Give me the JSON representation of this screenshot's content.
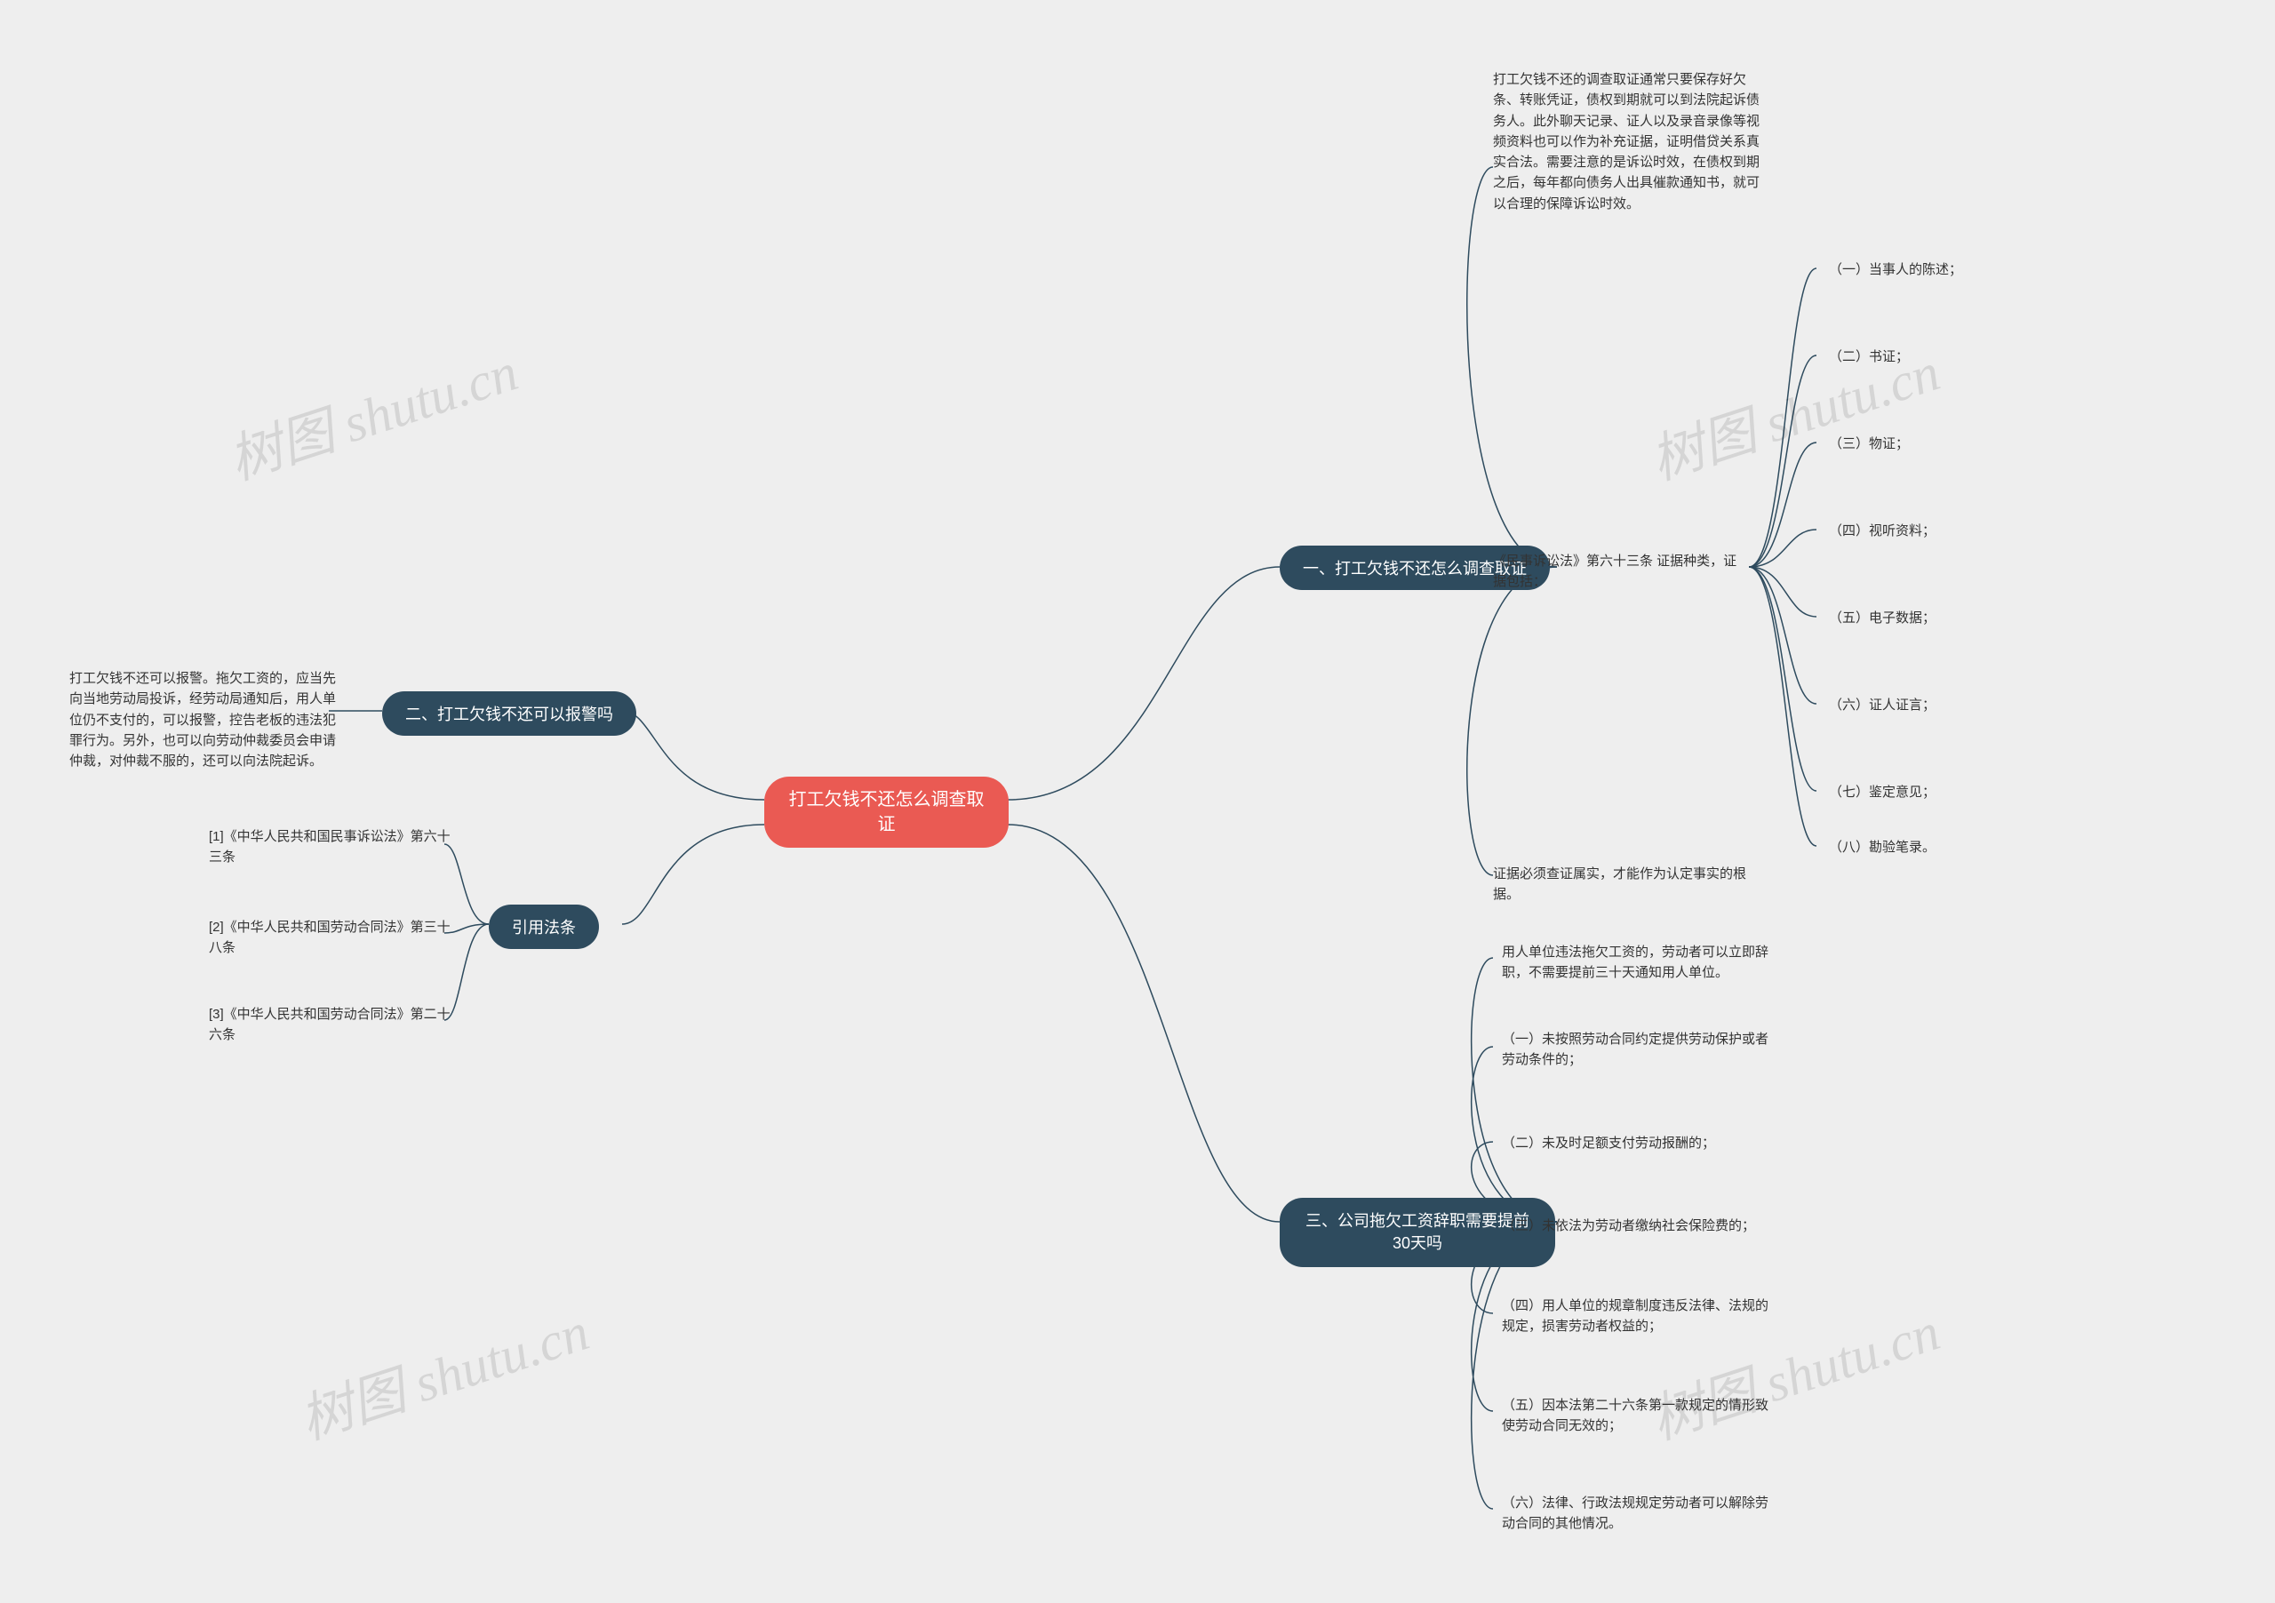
{
  "root": {
    "title": "打工欠钱不还怎么调查取证"
  },
  "branch1": {
    "title": "一、打工欠钱不还怎么调查取证",
    "intro": "打工欠钱不还的调查取证通常只要保存好欠条、转账凭证，债权到期就可以到法院起诉债务人。此外聊天记录、证人以及录音录像等视频资料也可以作为补充证据，证明借贷关系真实合法。需要注意的是诉讼时效，在债权到期之后，每年都向债务人出具催款通知书，就可以合理的保障诉讼时效。",
    "law_line": "《民事诉讼法》第六十三条 证据种类，证据包括：",
    "items": {
      "i1": "（一）当事人的陈述；",
      "i2": "（二）书证；",
      "i3": "（三）物证；",
      "i4": "（四）视听资料；",
      "i5": "（五）电子数据；",
      "i6": "（六）证人证言；",
      "i7": "（七）鉴定意见；",
      "i8": "（八）勘验笔录。"
    },
    "footer": "证据必须查证属实，才能作为认定事实的根据。"
  },
  "branch2": {
    "title": "二、打工欠钱不还可以报警吗",
    "content": "打工欠钱不还可以报警。拖欠工资的，应当先向当地劳动局投诉，经劳动局通知后，用人单位仍不支付的，可以报警，控告老板的违法犯罪行为。另外，也可以向劳动仲裁委员会申请仲裁，对仲裁不服的，还可以向法院起诉。"
  },
  "branch3": {
    "title": "三、公司拖欠工资辞职需要提前30天吗",
    "intro": "用人单位违法拖欠工资的，劳动者可以立即辞职，不需要提前三十天通知用人单位。",
    "items": {
      "i1": "（一）未按照劳动合同约定提供劳动保护或者劳动条件的；",
      "i2": "（二）未及时足额支付劳动报酬的；",
      "i3": "（三）未依法为劳动者缴纳社会保险费的；",
      "i4": "（四）用人单位的规章制度违反法律、法规的规定，损害劳动者权益的；",
      "i5": "（五）因本法第二十六条第一款规定的情形致使劳动合同无效的；",
      "i6": "（六）法律、行政法规规定劳动者可以解除劳动合同的其他情况。"
    }
  },
  "branch4": {
    "title": "引用法条",
    "items": {
      "i1": "[1]《中华人民共和国民事诉讼法》第六十三条",
      "i2": "[2]《中华人民共和国劳动合同法》第三十八条",
      "i3": "[3]《中华人民共和国劳动合同法》第二十六条"
    }
  },
  "watermark": "树图 shutu.cn"
}
